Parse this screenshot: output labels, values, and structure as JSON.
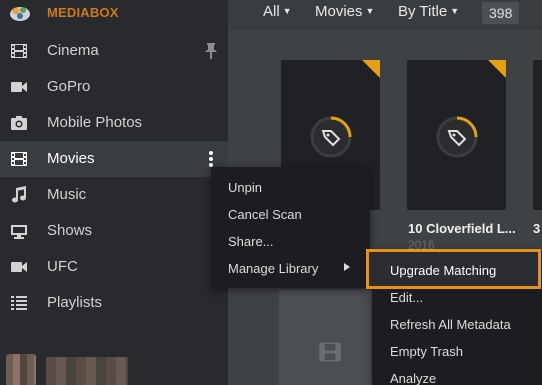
{
  "app": {
    "title": "MEDIABOX",
    "accent": "#cc7b19",
    "highlight": "#ec8f1b"
  },
  "sidebar": {
    "items": [
      {
        "label": "Cinema",
        "icon": "film-icon",
        "pinned": true
      },
      {
        "label": "GoPro",
        "icon": "video-camera-icon"
      },
      {
        "label": "Mobile Photos",
        "icon": "camera-icon"
      },
      {
        "label": "Movies",
        "icon": "film-icon",
        "active": true
      },
      {
        "label": "Music",
        "icon": "music-note-icon"
      },
      {
        "label": "Shows",
        "icon": "tv-icon"
      },
      {
        "label": "UFC",
        "icon": "video-camera-icon"
      },
      {
        "label": "Playlists",
        "icon": "list-icon"
      }
    ]
  },
  "topbar": {
    "filter_all": "All",
    "filter_type": "Movies",
    "sort": "By Title",
    "count": "398"
  },
  "posters": [
    {
      "title": "",
      "year": ""
    },
    {
      "title": "10 Cloverfield L...",
      "year": "2016"
    },
    {
      "title": "3",
      "year": ""
    }
  ],
  "context_menu": {
    "items": [
      "Unpin",
      "Cancel Scan",
      "Share...",
      "Manage Library"
    ]
  },
  "submenu": {
    "items": [
      "Upgrade Matching",
      "Edit...",
      "Refresh All Metadata",
      "Empty Trash",
      "Analyze"
    ]
  }
}
